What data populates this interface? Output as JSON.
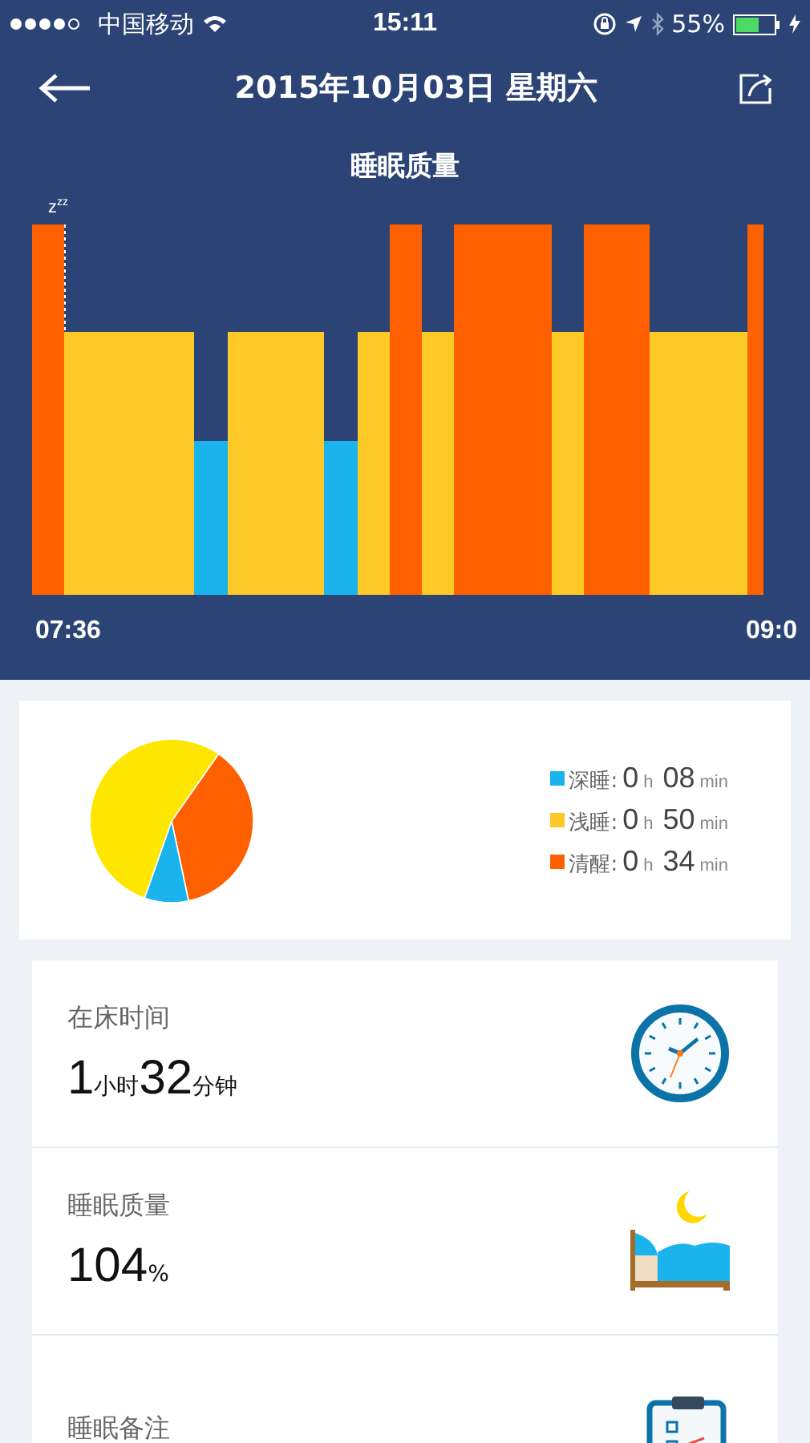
{
  "status_bar": {
    "carrier": "中国移动",
    "time": "15:11",
    "battery": "55%"
  },
  "header": {
    "title": "2015年10月03日 星期六"
  },
  "sleep_chart": {
    "title": "睡眠质量",
    "sleep_marker": "z$^{zz}$",
    "start_label": "07:36",
    "end_label": "09:0"
  },
  "summary": {
    "legend": [
      {
        "label": "深睡:",
        "hours": "0",
        "hour_unit": "h",
        "minutes": "08",
        "minute_unit": "min",
        "color": "#1ab3ec"
      },
      {
        "label": "浅睡:",
        "hours": "0",
        "hour_unit": "h",
        "minutes": "50",
        "minute_unit": "min",
        "color": "#fdc926"
      },
      {
        "label": "清醒:",
        "hours": "0",
        "hour_unit": "h",
        "minutes": "34",
        "minute_unit": "min",
        "color": "#fe6000"
      }
    ]
  },
  "stats": [
    {
      "kind": "clock",
      "label": "在床时间",
      "value": [
        {
          "kind": "number",
          "text": "1"
        },
        {
          "kind": "unit",
          "text": "小时"
        },
        {
          "kind": "number",
          "text": "32"
        },
        {
          "kind": "unit",
          "text": "分钟"
        }
      ]
    },
    {
      "kind": "bed",
      "label": "睡眠质量",
      "value": [
        {
          "kind": "number",
          "text": "104"
        },
        {
          "kind": "unit",
          "text": "%"
        }
      ]
    },
    {
      "kind": "clipboard",
      "label": "睡眠备注"
    }
  ]
}
